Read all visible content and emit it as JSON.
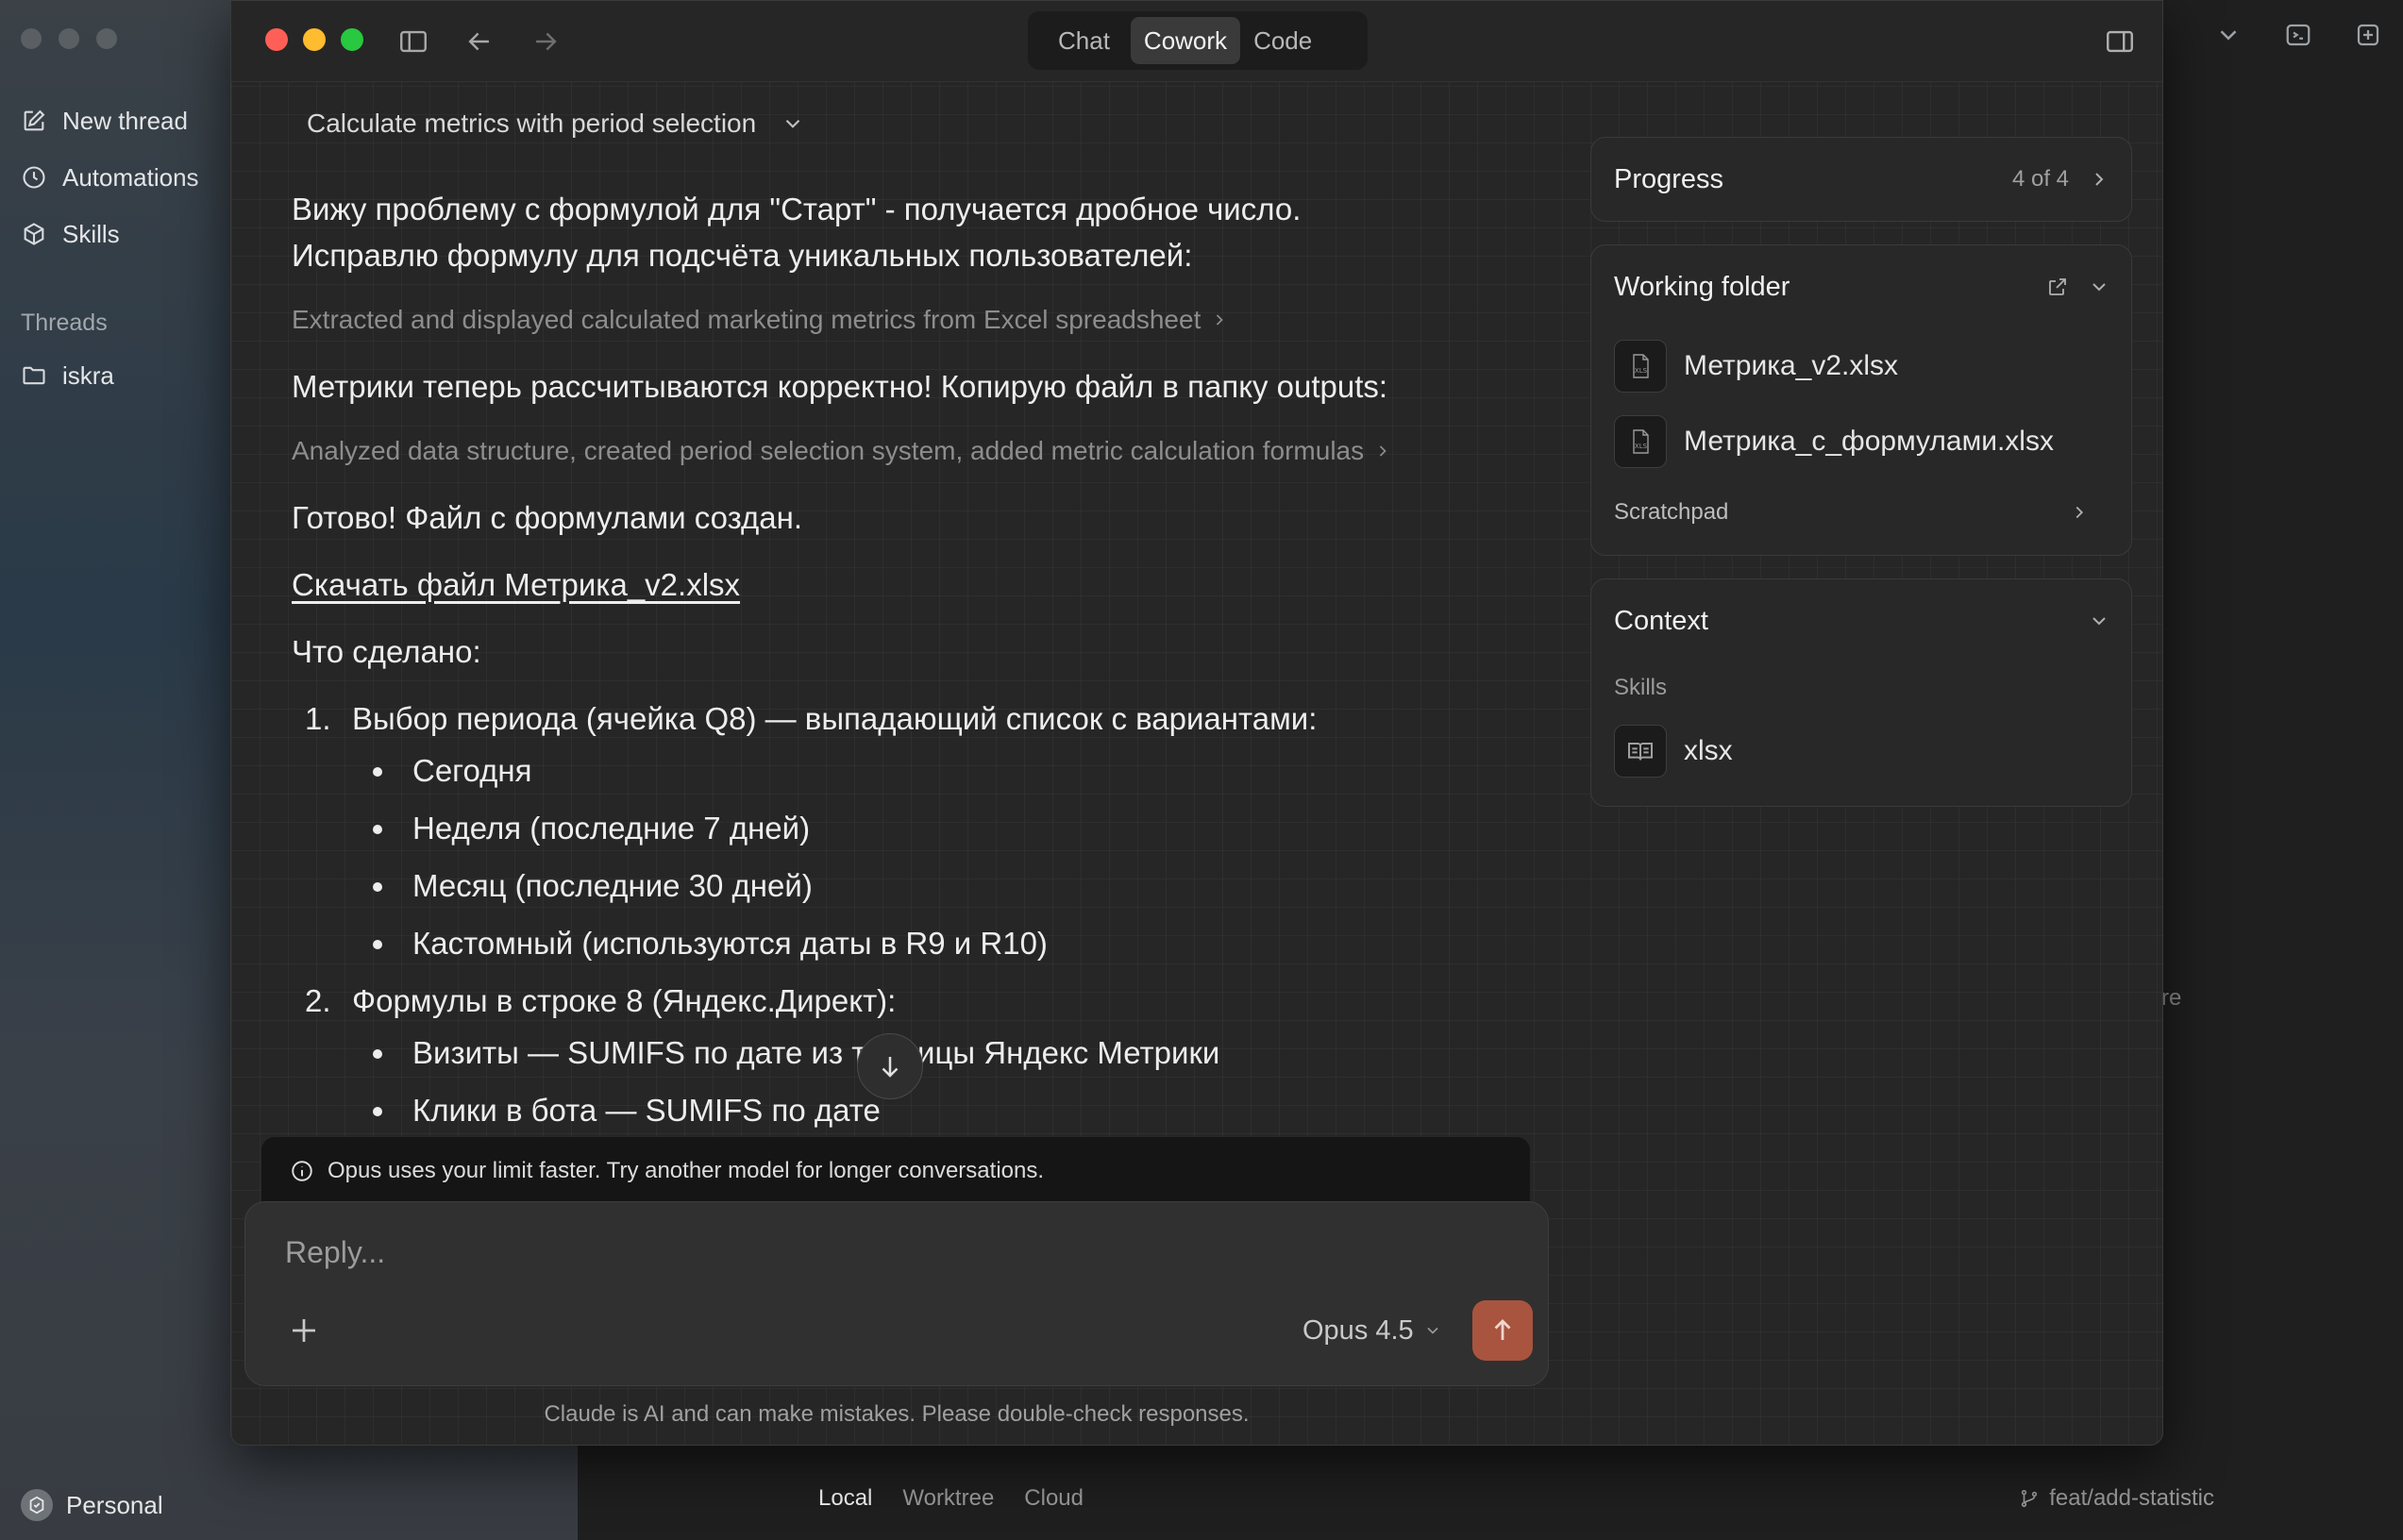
{
  "background_app": {
    "sidebar": {
      "new_thread": "New thread",
      "automations": "Automations",
      "skills": "Skills",
      "threads_heading": "Threads",
      "thread_items": [
        "iskra"
      ],
      "account": "Personal"
    },
    "bottom_bar": {
      "tabs": [
        "Local",
        "Worktree",
        "Cloud"
      ],
      "active_tab": "Local",
      "branch": "feat/add-statistic"
    },
    "partial_text": "re"
  },
  "window": {
    "modes": [
      "Chat",
      "Cowork",
      "Code"
    ],
    "active_mode": "Cowork",
    "thread_title": "Calculate metrics with period selection",
    "messages": {
      "intro_line1": "Вижу проблему с формулой для \"Старт\" - получается дробное число.",
      "intro_line2": "Исправлю формулу для подсчёта уникальных пользователей:",
      "step1": "Extracted and displayed calculated marketing metrics from Excel spreadsheet",
      "metrics_ok": "Метрики теперь рассчитываются корректно! Копирую файл в папку outputs:",
      "step2": "Analyzed data structure, created period selection system, added metric calculation formulas",
      "done": "Готово! Файл с формулами создан.",
      "download_link": "Скачать файл Метрика_v2.xlsx",
      "what_done": "Что сделано:",
      "list": [
        {
          "num": "1.",
          "text": "Выбор периода (ячейка Q8) — выпадающий список с вариантами:",
          "sub": [
            "Сегодня",
            "Неделя (последние 7 дней)",
            "Месяц (последние 30 дней)",
            "Кастомный (используются даты в R9 и R10)"
          ]
        },
        {
          "num": "2.",
          "text": "Формулы в строке 8 (Яндекс.Директ):",
          "sub": [
            "Визиты — SUMIFS по дате из таблицы Яндекс Метрики",
            "Клики в бота — SUMIFS по дате"
          ]
        }
      ]
    },
    "notice": "Opus uses your limit faster. Try another model for longer conversations.",
    "composer": {
      "placeholder": "Reply...",
      "model": "Opus 4.5"
    },
    "disclaimer": "Claude is AI and can make mistakes. Please double-check responses.",
    "progress": {
      "label": "Progress",
      "count": "4 of 4"
    },
    "working_folder": {
      "label": "Working folder",
      "files": [
        "Метрика_v2.xlsx",
        "Метрика_с_формулами.xlsx"
      ],
      "file_icon_text": "XLS",
      "scratchpad": "Scratchpad"
    },
    "context": {
      "label": "Context",
      "skills_label": "Skills",
      "skills": [
        "xlsx"
      ]
    }
  },
  "colors": {
    "accent_send": "#a8543f",
    "traffic_red": "#ff5f57",
    "traffic_yellow": "#febc2e",
    "traffic_green": "#28c840"
  }
}
